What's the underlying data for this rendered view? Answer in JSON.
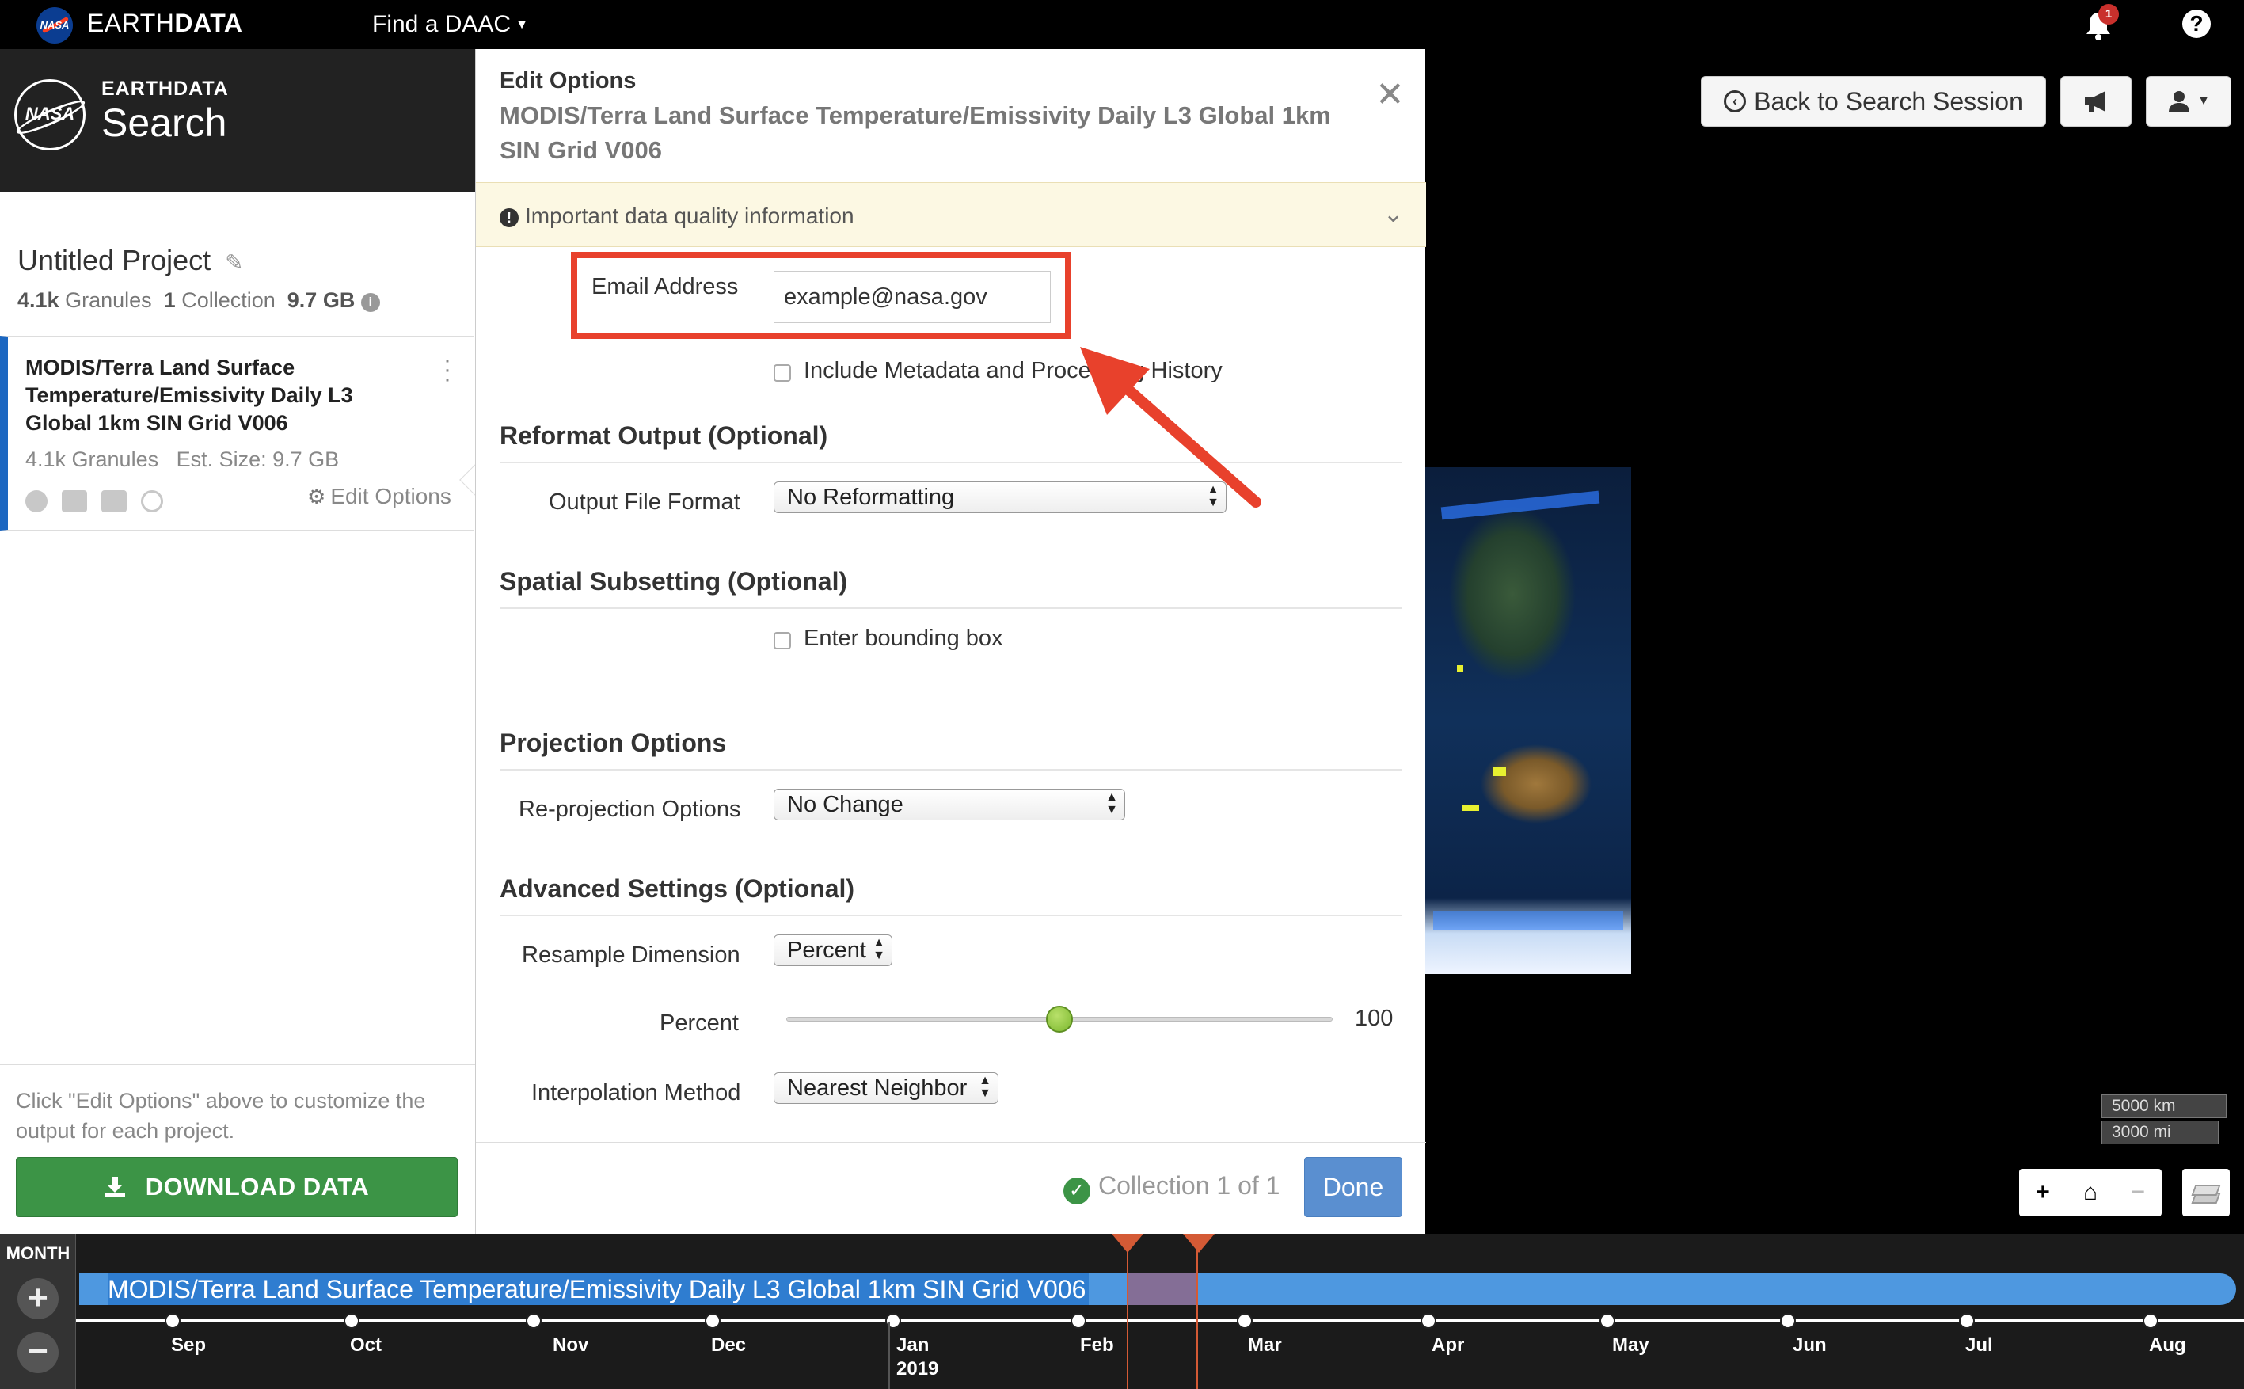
{
  "topbar": {
    "brand_prefix": "EARTH",
    "brand_suffix": "DATA",
    "nasa_mark": "NASA",
    "find_daac": "Find a DAAC",
    "notification_count": "1",
    "help": "?"
  },
  "sidebar": {
    "logo_mark": "NASA",
    "earthdata": "EARTHDATA",
    "search": "Search",
    "project_title": "Untitled Project",
    "stats": {
      "granules_value": "4.1k",
      "granules_label": "Granules",
      "collections_value": "1",
      "collections_label": "Collection",
      "size": "9.7 GB"
    },
    "collection": {
      "title": "MODIS/Terra Land Surface Temperature/Emissivity Daily L3 Global 1km SIN Grid V006",
      "granules": "4.1k Granules",
      "est_size": "Est. Size: 9.7 GB",
      "edit_options": "Edit Options"
    },
    "hint": "Click \"Edit Options\" above to customize the output for each project.",
    "download_label": "DOWNLOAD DATA"
  },
  "modal": {
    "label": "Edit Options",
    "title": "MODIS/Terra Land Surface Temperature/Emissivity Daily L3 Global 1km SIN Grid V006",
    "quality_info": "Important data quality information",
    "email_label": "Email Address",
    "email_value": "example@nasa.gov",
    "include_metadata_label": "Include Metadata and Processing History",
    "reformat_heading": "Reformat Output (Optional)",
    "output_format_label": "Output File Format",
    "output_format_value": "No Reformatting",
    "spatial_heading": "Spatial Subsetting (Optional)",
    "bounding_box_label": "Enter bounding box",
    "projection_heading": "Projection Options",
    "reprojection_label": "Re-projection Options",
    "reprojection_value": "No Change",
    "advanced_heading": "Advanced Settings (Optional)",
    "resample_label": "Resample Dimension",
    "resample_value": "Percent",
    "percent_label": "Percent",
    "percent_value": "100",
    "percent_slider_position": 0.5,
    "interpolation_label": "Interpolation Method",
    "interpolation_value": "Nearest Neighbor",
    "collection_counter": "Collection 1 of 1",
    "done_label": "Done"
  },
  "map": {
    "back_to_session": "Back to Search Session",
    "scale_km": "5000 km",
    "scale_mi": "3000 mi",
    "zoom_in": "+",
    "home": "⌂",
    "zoom_out": "−"
  },
  "timeline": {
    "resolution": "MONTH",
    "zoom_in": "+",
    "zoom_out": "−",
    "bar_label": "MODIS/Terra Land Surface Temperature/Emissivity Daily L3 Global 1km SIN Grid V006",
    "months": [
      "Sep",
      "Oct",
      "Nov",
      "Dec",
      "Jan",
      "Feb",
      "Mar",
      "Apr",
      "May",
      "Jun",
      "Jul",
      "Aug"
    ],
    "year_label": "2019"
  },
  "colors": {
    "highlight": "#e8412c",
    "primary_blue": "#1c67c1",
    "download_green": "#3c9446",
    "timeline_bar": "#4e98e0",
    "selection": "#d45a35"
  }
}
